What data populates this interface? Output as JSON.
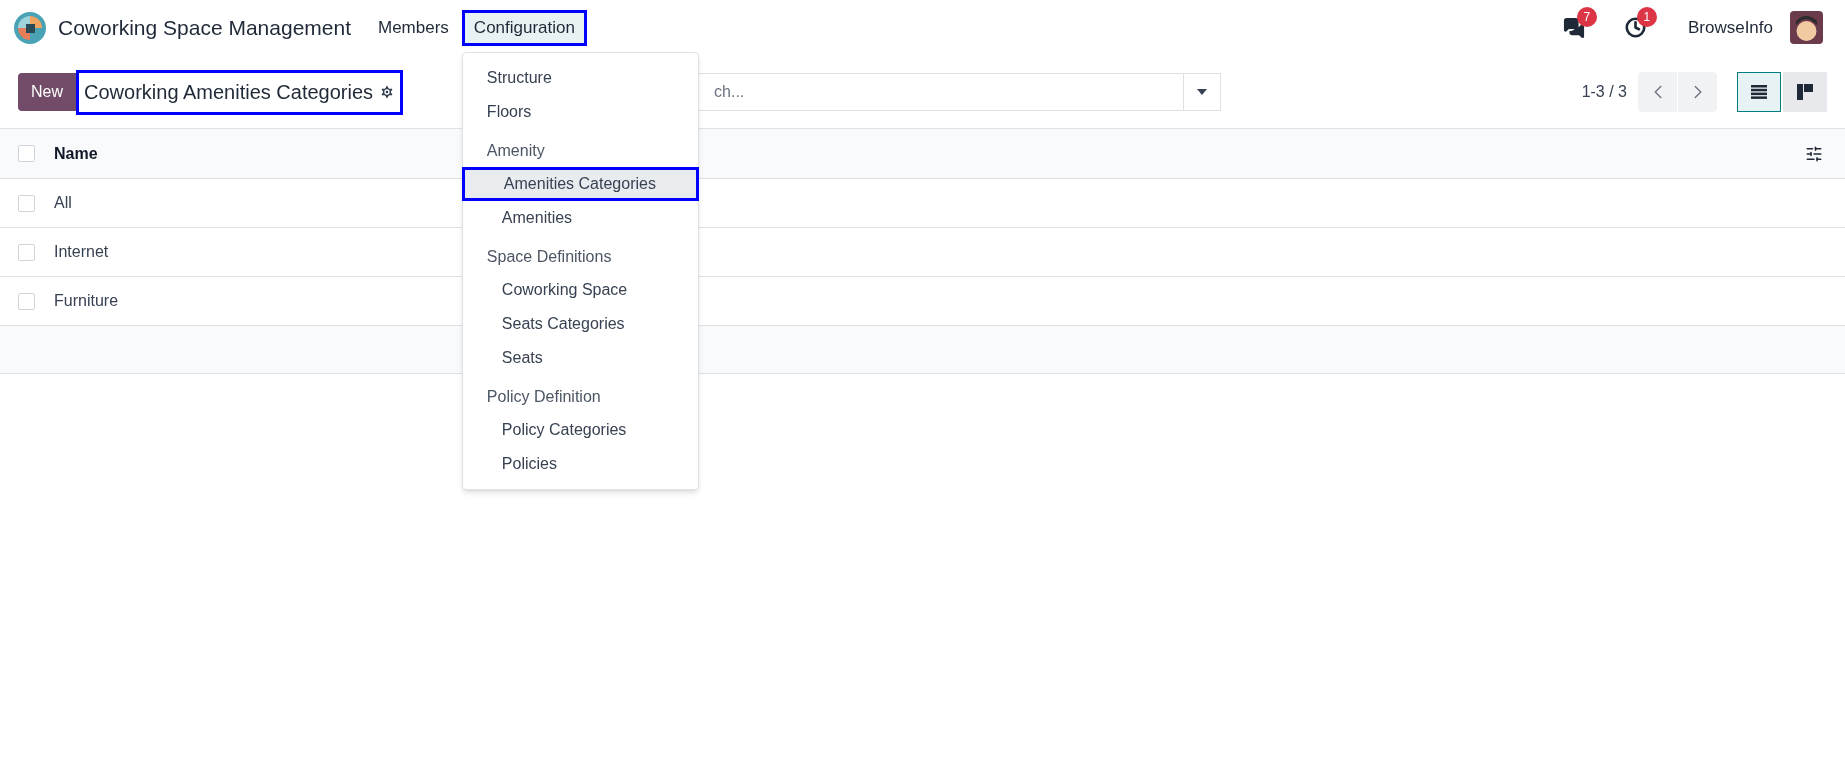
{
  "app": {
    "title": "Coworking Space Management"
  },
  "nav": [
    {
      "label": "Members",
      "highlighted": false
    },
    {
      "label": "Configuration",
      "highlighted": true
    }
  ],
  "systray": {
    "messages_badge": "7",
    "activities_badge": "1",
    "user": "BrowseInfo"
  },
  "control_panel": {
    "new_button": "New",
    "breadcrumb": {
      "label": "Coworking Amenities Categories",
      "highlighted": true
    },
    "search": {
      "placeholder": "ch..."
    },
    "pager": "1-3 / 3",
    "views": [
      {
        "kind": "list",
        "selected": true
      },
      {
        "kind": "kanban",
        "selected": false
      }
    ]
  },
  "menu": [
    {
      "kind": "item",
      "label": "Structure",
      "highlighted": false
    },
    {
      "kind": "item",
      "label": "Floors",
      "highlighted": false
    },
    {
      "kind": "header",
      "label": "Amenity"
    },
    {
      "kind": "subitem",
      "label": "Amenities Categories",
      "highlighted": true
    },
    {
      "kind": "subitem",
      "label": "Amenities",
      "highlighted": false
    },
    {
      "kind": "header",
      "label": "Space Definitions"
    },
    {
      "kind": "subitem",
      "label": "Coworking Space",
      "highlighted": false
    },
    {
      "kind": "subitem",
      "label": "Seats Categories",
      "highlighted": false
    },
    {
      "kind": "subitem",
      "label": "Seats",
      "highlighted": false
    },
    {
      "kind": "header",
      "label": "Policy Definition"
    },
    {
      "kind": "subitem",
      "label": "Policy Categories",
      "highlighted": false
    },
    {
      "kind": "subitem",
      "label": "Policies",
      "highlighted": false
    }
  ],
  "table": {
    "columns": [
      "Name"
    ],
    "select_all_checked": false,
    "rows": [
      {
        "name": "All",
        "checked": false
      },
      {
        "name": "Internet",
        "checked": false
      },
      {
        "name": "Furniture",
        "checked": false
      }
    ]
  }
}
